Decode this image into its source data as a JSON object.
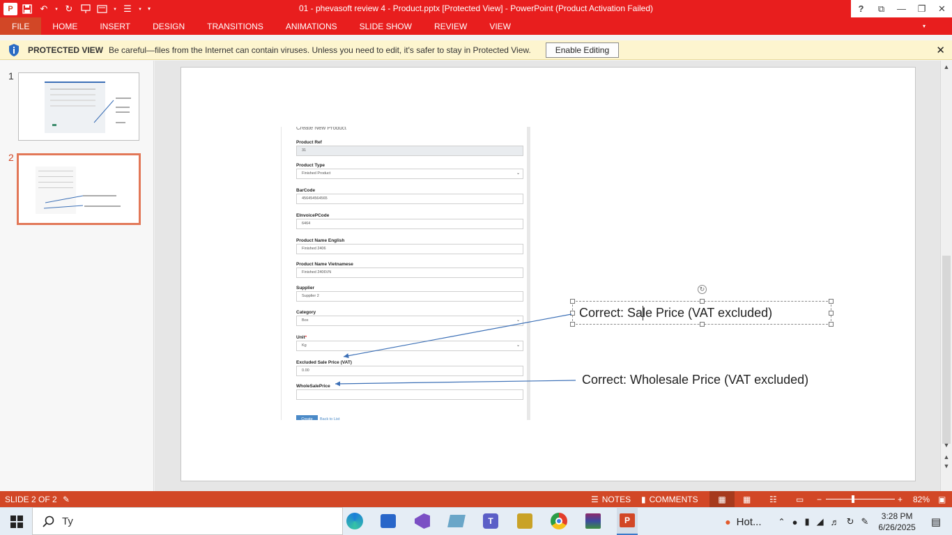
{
  "window": {
    "title": "01 - phevasoft review 4 - Product.pptx [Protected View] -  PowerPoint (Product Activation Failed)",
    "help": "?",
    "app_icon": "P"
  },
  "ribbon": {
    "file": "FILE",
    "tabs": [
      "HOME",
      "INSERT",
      "DESIGN",
      "TRANSITIONS",
      "ANIMATIONS",
      "SLIDE SHOW",
      "REVIEW",
      "VIEW"
    ]
  },
  "protected_view": {
    "label": "PROTECTED VIEW",
    "message": "Be careful—files from the Internet can contain viruses. Unless you need to edit, it's safer to stay in Protected View.",
    "button": "Enable Editing",
    "close": "✕"
  },
  "thumbnails": [
    {
      "number": "1",
      "selected": false
    },
    {
      "number": "2",
      "selected": true
    }
  ],
  "form": {
    "title": "Create New Product",
    "fields": [
      {
        "label": "Product Ref",
        "value": "31",
        "readonly": true,
        "select": false
      },
      {
        "label": "Product Type",
        "value": "Finished Product",
        "readonly": false,
        "select": true
      },
      {
        "label": "BarCode",
        "value": "456454564565",
        "readonly": false,
        "select": false
      },
      {
        "label": "EInvoicePCode",
        "value": "6464",
        "readonly": false,
        "select": false
      },
      {
        "label": "Product Name English",
        "value": "Finished 2406",
        "readonly": false,
        "select": false
      },
      {
        "label": "Product Name Vietnamese",
        "value": "Finished 2406VN",
        "readonly": false,
        "select": false
      },
      {
        "label": "Supplier",
        "value": "Supplier 2",
        "readonly": false,
        "select": false
      },
      {
        "label": "Category",
        "value": "Box",
        "readonly": false,
        "select": true
      },
      {
        "label": "Unit",
        "value": "Kg",
        "readonly": false,
        "select": true,
        "required": "*"
      },
      {
        "label": "Excluded Sale Price (VAT)",
        "value": "0.00",
        "readonly": false,
        "select": false
      },
      {
        "label": "WholeSalePrice",
        "value": "",
        "readonly": false,
        "select": false
      }
    ],
    "create_button": "Create",
    "back_link": "Back to List"
  },
  "annotations": {
    "sale_price": "Correct: Sale Price (VAT excluded)",
    "wholesale_price": "Correct: Wholesale Price (VAT excluded)"
  },
  "status": {
    "slide_counter": "SLIDE 2 OF 2",
    "notes": "NOTES",
    "comments": "COMMENTS",
    "zoom": "82%",
    "zoom_minus": "−",
    "zoom_plus": "+"
  },
  "taskbar": {
    "search_placeholder": "Ty",
    "weather": "Hot...",
    "time": "3:28 PM",
    "date": "6/26/2025"
  }
}
